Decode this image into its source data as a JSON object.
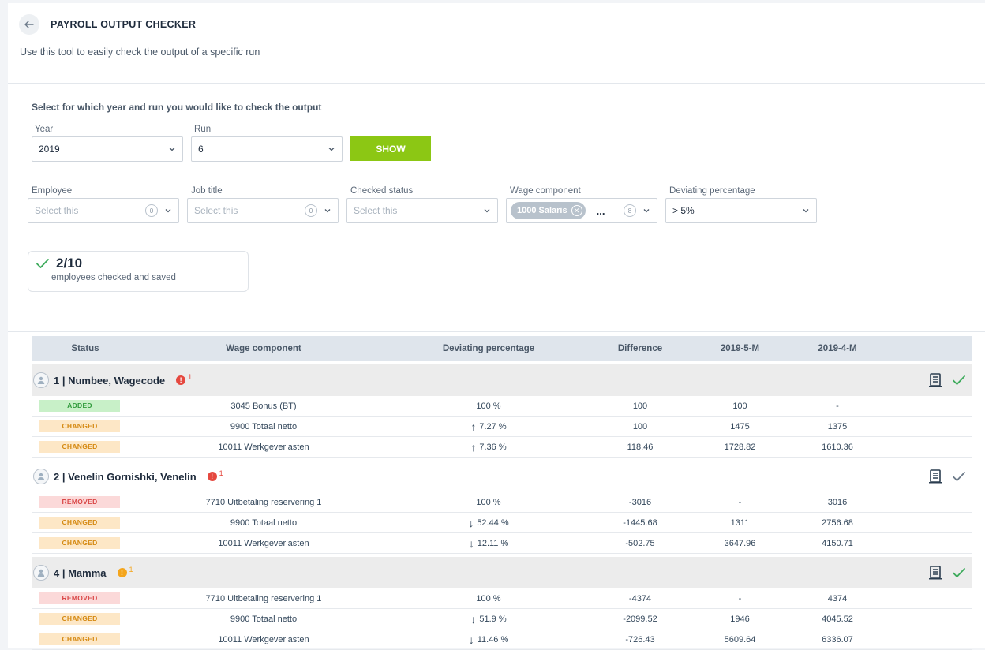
{
  "header": {
    "title": "PAYROLL OUTPUT CHECKER",
    "subtitle": "Use this tool to easily check the output of a specific run"
  },
  "selection": {
    "prompt": "Select for which year and run you would like to check the output",
    "year_label": "Year",
    "year_value": "2019",
    "run_label": "Run",
    "run_value": "6",
    "show_label": "SHOW"
  },
  "filters": {
    "employee": {
      "label": "Employee",
      "placeholder": "Select this",
      "count": "0"
    },
    "job_title": {
      "label": "Job title",
      "placeholder": "Select this",
      "count": "0"
    },
    "checked_status": {
      "label": "Checked status",
      "placeholder": "Select this"
    },
    "wage_component": {
      "label": "Wage component",
      "chip": "1000 Salaris",
      "more": "...",
      "count": "8"
    },
    "deviating_percentage": {
      "label": "Deviating percentage",
      "value": "> 5%"
    }
  },
  "summary": {
    "count": "2/10",
    "description": "employees checked and saved"
  },
  "table": {
    "headers": [
      "Status",
      "Wage component",
      "Deviating percentage",
      "Difference",
      "2019-5-M",
      "2019-4-M"
    ],
    "employees": [
      {
        "name": "1 | Numbee, Wagecode",
        "alert_count": "1",
        "alert_color": "#e5483f",
        "checked": true,
        "rows": [
          {
            "status": "ADDED",
            "component": "3045 Bonus (BT)",
            "arrow": "",
            "deviation": "100 %",
            "difference": "100",
            "p1": "100",
            "p2": "-"
          },
          {
            "status": "CHANGED",
            "component": "9900 Totaal netto",
            "arrow": "↑",
            "deviation": "7.27 %",
            "difference": "100",
            "p1": "1475",
            "p2": "1375"
          },
          {
            "status": "CHANGED",
            "component": "10011 Werkgeverlasten",
            "arrow": "↑",
            "deviation": "7.36 %",
            "difference": "118.46",
            "p1": "1728.82",
            "p2": "1610.36"
          }
        ]
      },
      {
        "name": "2 | Venelin Gornishki, Venelin",
        "alert_count": "1",
        "alert_color": "#e5483f",
        "checked": false,
        "rows": [
          {
            "status": "REMOVED",
            "component": "7710 Uitbetaling reservering 1",
            "arrow": "",
            "deviation": "100 %",
            "difference": "-3016",
            "p1": "-",
            "p2": "3016"
          },
          {
            "status": "CHANGED",
            "component": "9900 Totaal netto",
            "arrow": "↓",
            "deviation": "52.44 %",
            "difference": "-1445.68",
            "p1": "1311",
            "p2": "2756.68"
          },
          {
            "status": "CHANGED",
            "component": "10011 Werkgeverlasten",
            "arrow": "↓",
            "deviation": "12.11 %",
            "difference": "-502.75",
            "p1": "3647.96",
            "p2": "4150.71"
          }
        ]
      },
      {
        "name": "4 | Mamma",
        "alert_count": "1",
        "alert_color": "#f4a51c",
        "checked": true,
        "rows": [
          {
            "status": "REMOVED",
            "component": "7710 Uitbetaling reservering 1",
            "arrow": "",
            "deviation": "100 %",
            "difference": "-4374",
            "p1": "-",
            "p2": "4374"
          },
          {
            "status": "CHANGED",
            "component": "9900 Totaal netto",
            "arrow": "↓",
            "deviation": "51.9 %",
            "difference": "-2099.52",
            "p1": "1946",
            "p2": "4045.52"
          },
          {
            "status": "CHANGED",
            "component": "10011 Werkgeverlasten",
            "arrow": "↓",
            "deviation": "11.46 %",
            "difference": "-726.43",
            "p1": "5609.64",
            "p2": "6336.07"
          }
        ]
      }
    ]
  },
  "colors": {
    "accent_green": "#8cc714",
    "check_green": "#3dab5c",
    "check_grey": "#6c7a89"
  }
}
